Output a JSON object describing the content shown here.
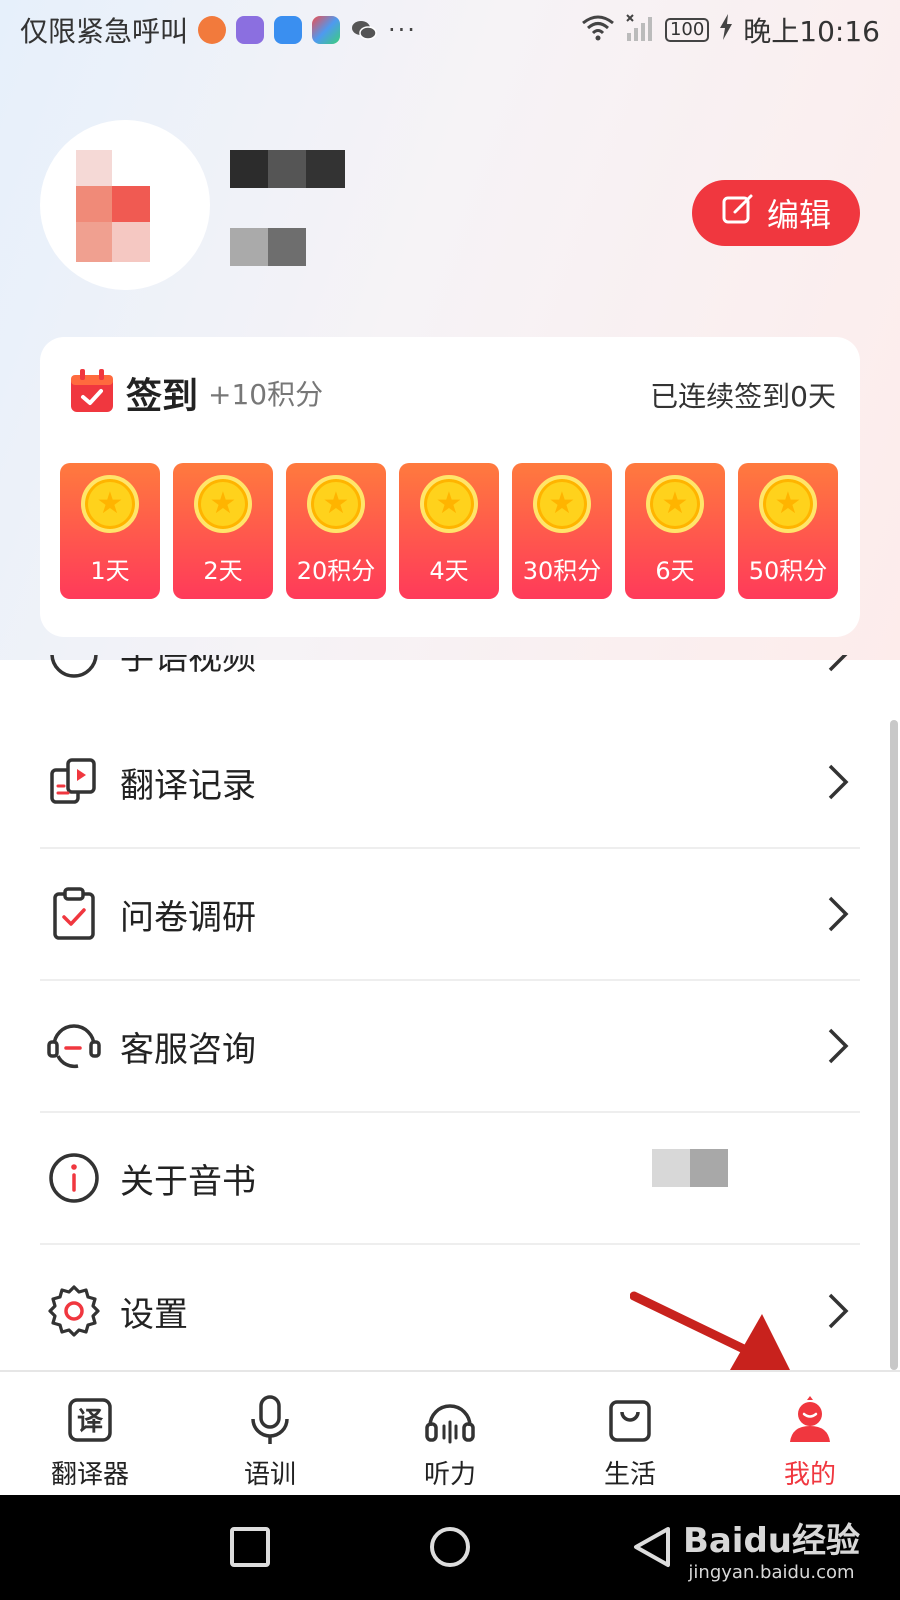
{
  "status_bar": {
    "carrier_text": "仅限紧急呼叫",
    "more_indicator": "···",
    "battery": "100",
    "time": "晚上10:16",
    "app_icons": [
      "weibo-icon",
      "app-purple-icon",
      "bulb-app-icon",
      "browser-icon",
      "wechat-icon"
    ]
  },
  "profile": {
    "edit_label": "编辑"
  },
  "checkin": {
    "title": "签到",
    "points": "+10积分",
    "streak": "已连续签到0天",
    "days": [
      "1天",
      "2天",
      "20积分",
      "4天",
      "30积分",
      "6天",
      "50积分"
    ]
  },
  "menu": {
    "partial_label": "手语视频",
    "items": [
      {
        "label": "翻译记录",
        "icon": "translation-record-icon"
      },
      {
        "label": "问卷调研",
        "icon": "survey-clipboard-icon"
      },
      {
        "label": "客服咨询",
        "icon": "customer-service-icon"
      },
      {
        "label": "关于音书",
        "icon": "info-icon"
      },
      {
        "label": "设置",
        "icon": "gear-icon"
      }
    ]
  },
  "tabs": [
    {
      "label": "翻译器",
      "icon": "translator-icon",
      "active": false
    },
    {
      "label": "语训",
      "icon": "microphone-icon",
      "active": false
    },
    {
      "label": "听力",
      "icon": "headphones-icon",
      "active": false
    },
    {
      "label": "生活",
      "icon": "shopping-bag-icon",
      "active": false
    },
    {
      "label": "我的",
      "icon": "profile-icon",
      "active": true
    }
  ],
  "watermark": {
    "main": "Baidu经验",
    "sub": "jingyan.baidu.com"
  },
  "colors": {
    "accent": "#f0373f",
    "coin": "#ffd21c",
    "card_gradient_top": "#ff7a3e",
    "card_gradient_bottom": "#ff3a5a"
  }
}
